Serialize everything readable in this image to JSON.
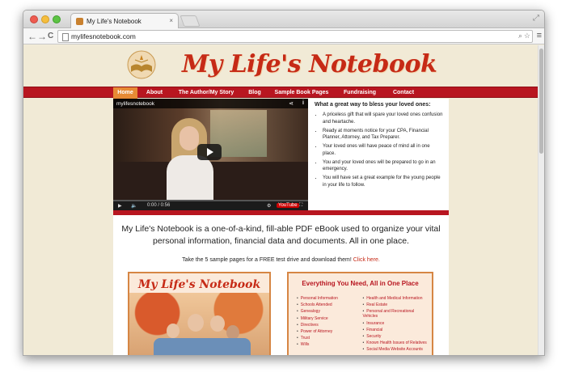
{
  "browser": {
    "tab_title": "My Life's Notebook",
    "tab_close": "×",
    "url": "mylifesnotebook.com",
    "back": "←",
    "forward": "→",
    "reload": "C",
    "menu": "≡",
    "zoom": "⌕",
    "star": "☆",
    "resize": "⤢"
  },
  "site": {
    "title": "My Life's Notebook",
    "accent": "#b81620",
    "active_nav": "#e78a34",
    "nav": [
      {
        "label": "Home",
        "active": true
      },
      {
        "label": "About",
        "active": false
      },
      {
        "label": "The Author/My Story",
        "active": false
      },
      {
        "label": "Blog",
        "active": false
      },
      {
        "label": "Sample Book Pages",
        "active": false
      },
      {
        "label": "Fundraising",
        "active": false
      },
      {
        "label": "Contact",
        "active": false
      }
    ]
  },
  "video": {
    "channel": "mylifesnotebook",
    "share": "⋖",
    "info": "i",
    "time": "0:00 / 0:56",
    "play_ctl": "▶",
    "volume_ctl": "🔈",
    "settings_ctl": "⚙",
    "yt_logo": "YouTube",
    "fullscreen_ctl": "⛶"
  },
  "benefits": {
    "heading": "What a great way to bless your loved ones:",
    "items": [
      "A priceless gift that will spare your loved ones confusion and heartache.",
      "Ready at moments notice for your CPA, Financial Planner, Attorney, and Tax Preparer.",
      "Your loved ones will have peace of mind all in one place.",
      "You and your loved ones will be prepared to go in an emergency.",
      "You will have set a great example for the young people in your life to follow."
    ]
  },
  "intro": "My Life's Notebook is a one-of-a-kind, fill-able PDF eBook used to organize your vital personal information, financial data and documents. All in one place.",
  "cta": {
    "text": "Take the 5 sample pages for a FREE test drive and download them!",
    "link": "Click here."
  },
  "book_panel": {
    "title": "My Life's Notebook"
  },
  "everything_panel": {
    "title": "Everything You Need, All in One Place",
    "left": [
      "Personal Information",
      "Schools Attended",
      "Genealogy",
      "Military Service",
      "Directives",
      "Power of Attorney",
      "Trust",
      "Wills"
    ],
    "right": [
      "Health and Medical Information",
      "Real Estate",
      "Personal and Recreational Vehicles",
      "Insurance",
      "Financial",
      "Security",
      "Known Health Issues of Relatives",
      "Social Media Website Accounts"
    ]
  }
}
